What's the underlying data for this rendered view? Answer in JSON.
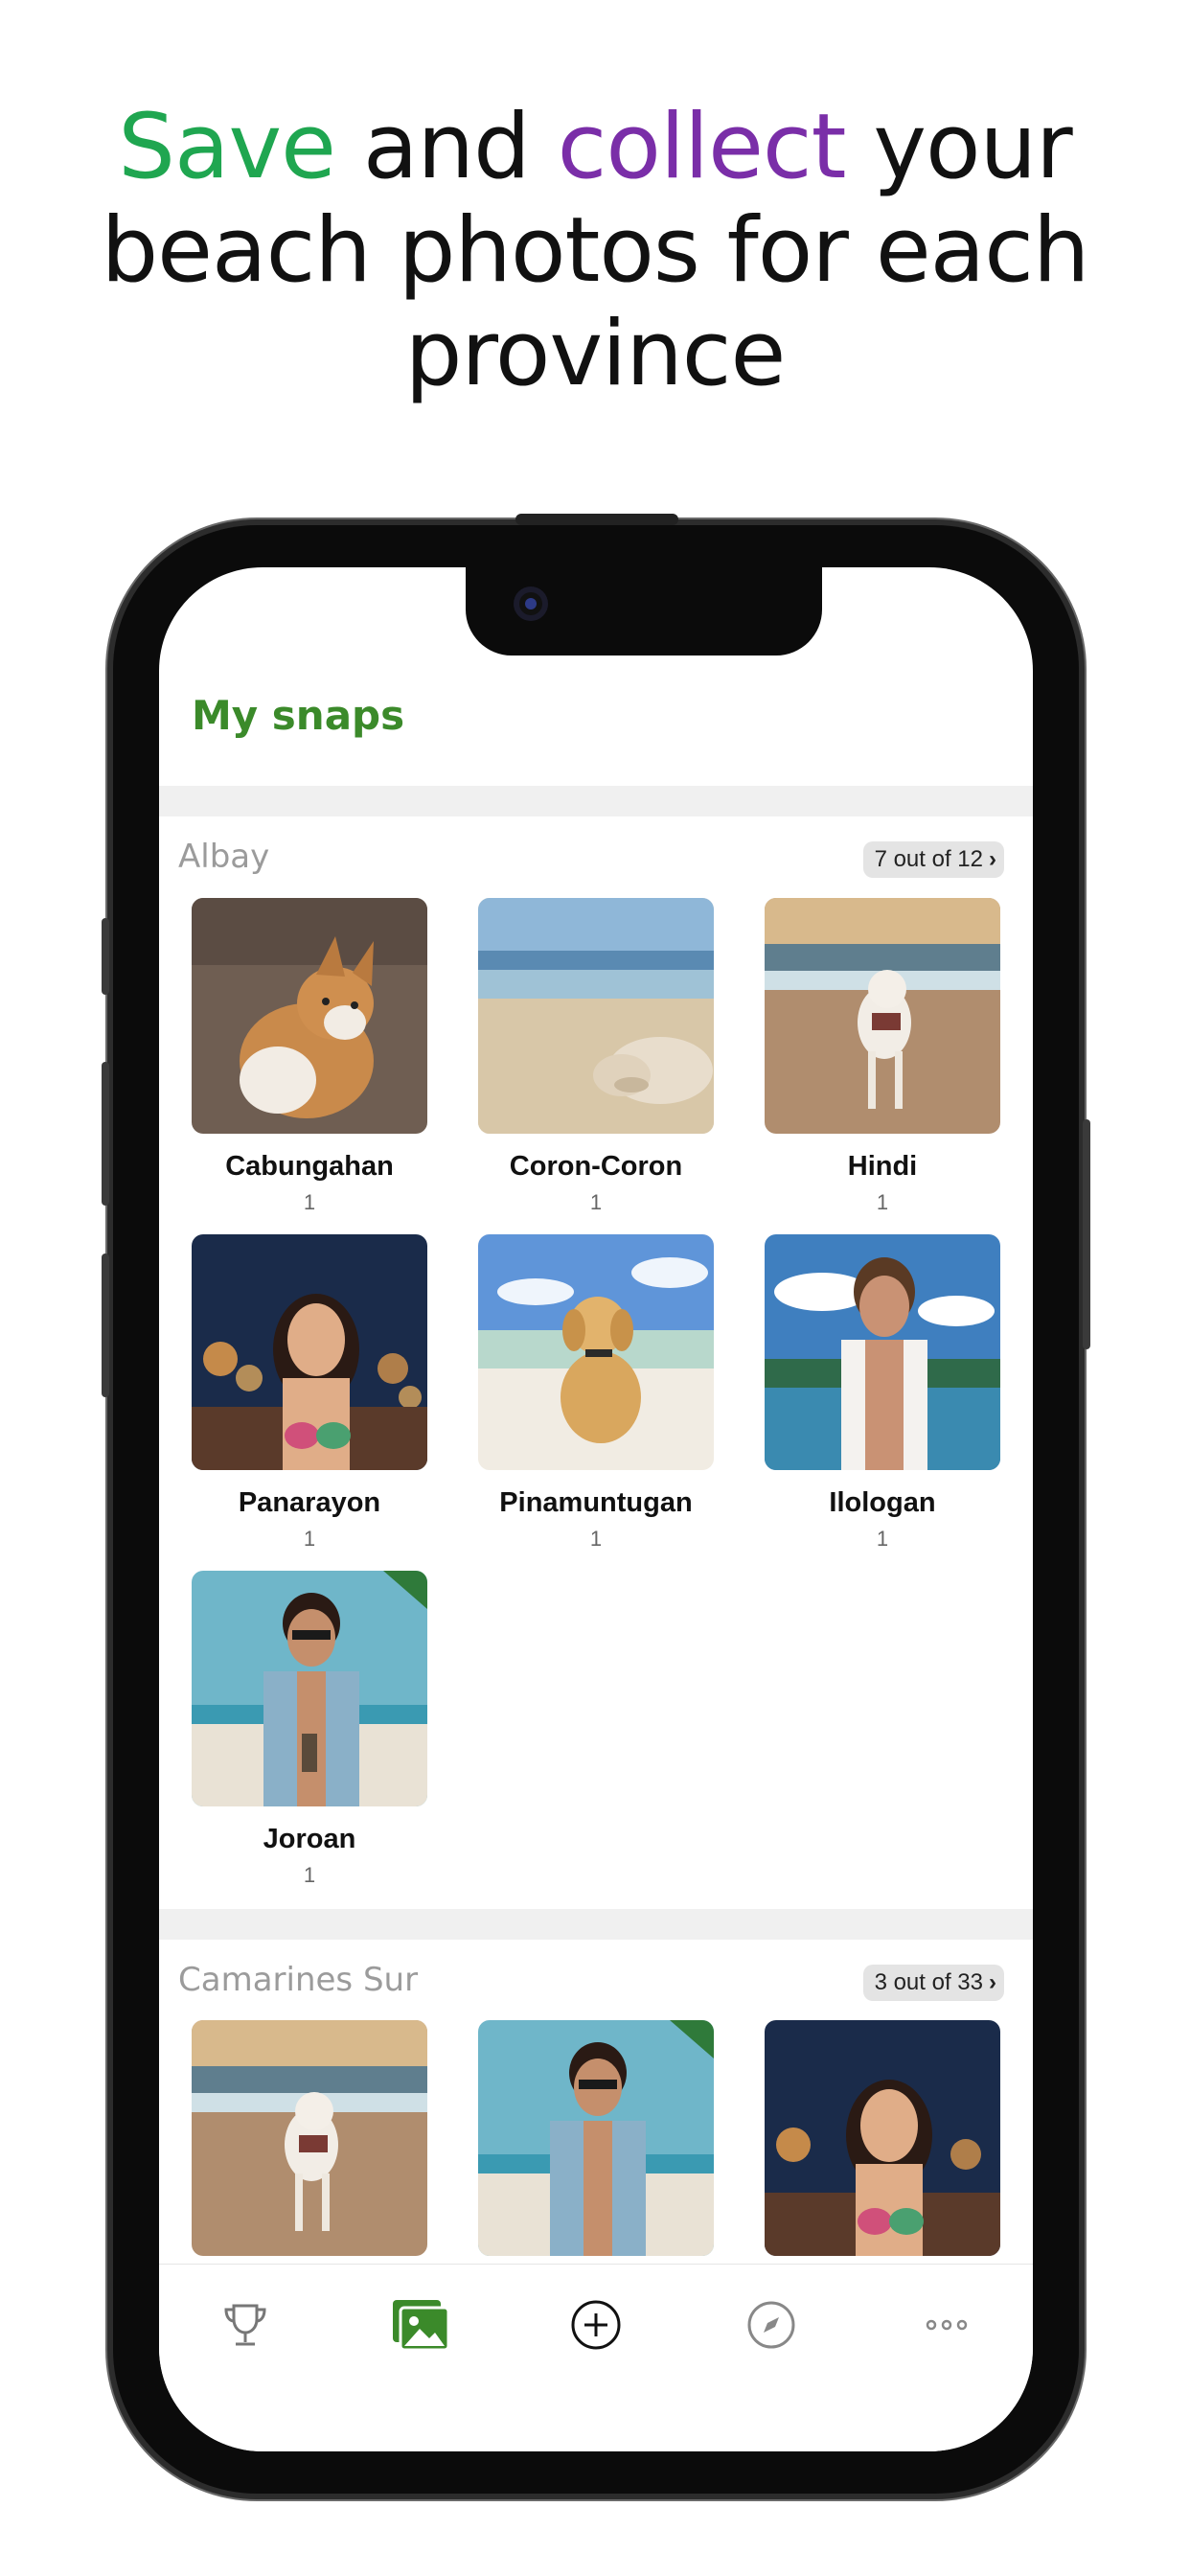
{
  "headline": {
    "word1": "Save",
    "word2": "and",
    "word3": "collect",
    "rest_line1": "your",
    "line2": "beach photos for each",
    "line3": "province",
    "colors": {
      "save": "#1fa650",
      "collect": "#7a2ea8"
    }
  },
  "app": {
    "title": "My snaps",
    "accent": "#3b8a2a"
  },
  "sections": [
    {
      "title": "Albay",
      "badge": "7 out of 12",
      "items": [
        {
          "name": "Cabungahan",
          "count": "1",
          "photo": "dog-sand"
        },
        {
          "name": "Coron-Coron",
          "count": "1",
          "photo": "dog-sleeping-beach"
        },
        {
          "name": "Hindi",
          "count": "1",
          "photo": "dog-walking-beach"
        },
        {
          "name": "Panarayon",
          "count": "1",
          "photo": "woman-night-beach"
        },
        {
          "name": "Pinamuntugan",
          "count": "1",
          "photo": "puppy-beach"
        },
        {
          "name": "Ilologan",
          "count": "1",
          "photo": "man-white-shirt-beach"
        },
        {
          "name": "Joroan",
          "count": "1",
          "photo": "man-sunglasses-beach"
        }
      ]
    },
    {
      "title": "Camarines Sur",
      "badge": "3 out of 33",
      "items": [
        {
          "name": "",
          "count": "",
          "photo": "dog-walking-beach"
        },
        {
          "name": "",
          "count": "",
          "photo": "man-sunglasses-beach"
        },
        {
          "name": "",
          "count": "",
          "photo": "woman-night-beach"
        }
      ]
    }
  ],
  "tabbar": {
    "tabs": [
      {
        "icon": "trophy-icon"
      },
      {
        "icon": "photos-icon",
        "active": true
      },
      {
        "icon": "add-circle-icon"
      },
      {
        "icon": "compass-icon"
      },
      {
        "icon": "more-icon"
      }
    ]
  }
}
